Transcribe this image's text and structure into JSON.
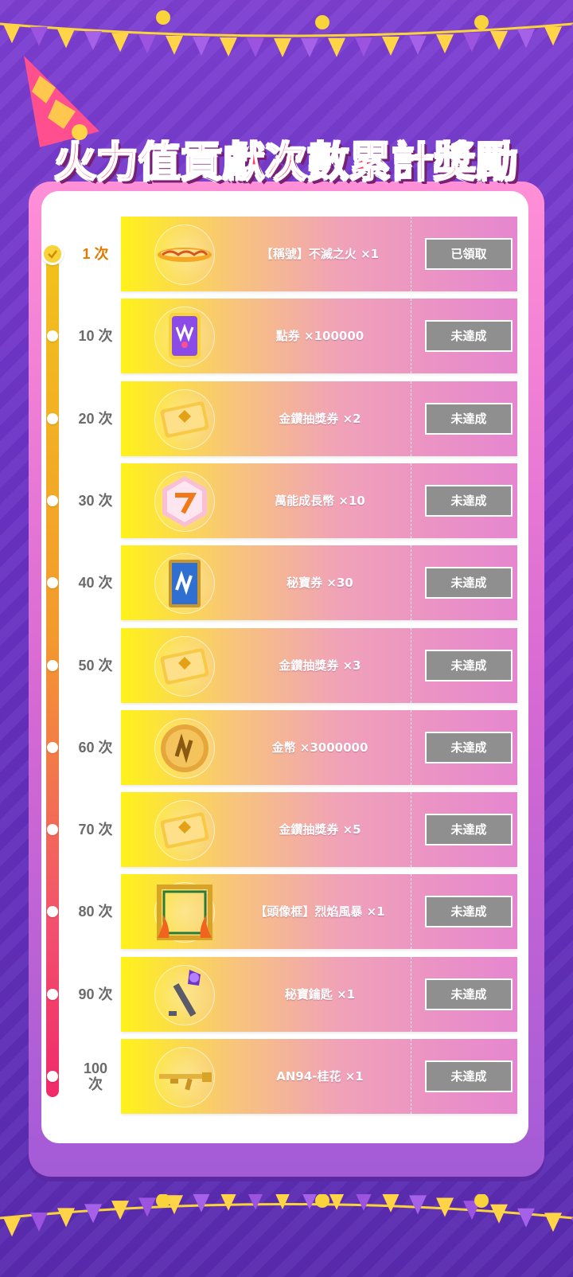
{
  "title": "火力值貢獻次數累計獎勵",
  "colors": {
    "accent_title": "#ff3b66",
    "button_gray": "#8f8f8f",
    "timeline_top": "#f2c21a",
    "timeline_bottom": "#f02a6a",
    "active_count": "#e07a00"
  },
  "rewards": [
    {
      "count": "1 次",
      "icon": "flaming-bar-icon",
      "reward": "【稱號】不滅之火 ×1",
      "status": "已領取",
      "done": true
    },
    {
      "count": "10 次",
      "icon": "voucher-card-icon",
      "reward": "點券 ×100000",
      "status": "未達成",
      "done": false
    },
    {
      "count": "20 次",
      "icon": "gold-ticket-icon",
      "reward": "金鑽抽獎券 ×2",
      "status": "未達成",
      "done": false
    },
    {
      "count": "30 次",
      "icon": "growth-coin-icon",
      "reward": "萬能成長幣 ×10",
      "status": "未達成",
      "done": false
    },
    {
      "count": "40 次",
      "icon": "treasure-card-icon",
      "reward": "秘寶券 ×30",
      "status": "未達成",
      "done": false
    },
    {
      "count": "50 次",
      "icon": "gold-ticket-icon",
      "reward": "金鑽抽獎券 ×3",
      "status": "未達成",
      "done": false
    },
    {
      "count": "60 次",
      "icon": "gold-coin-icon",
      "reward": "金幣 ×3000000",
      "status": "未達成",
      "done": false
    },
    {
      "count": "70 次",
      "icon": "gold-ticket-icon",
      "reward": "金鑽抽獎券 ×5",
      "status": "未達成",
      "done": false
    },
    {
      "count": "80 次",
      "icon": "avatar-frame-icon",
      "reward": "【頭像框】烈焰風暴 ×1",
      "status": "未達成",
      "done": false
    },
    {
      "count": "90 次",
      "icon": "treasure-key-icon",
      "reward": "秘寶鑰匙 ×1",
      "status": "未達成",
      "done": false
    },
    {
      "count": "100\n次",
      "icon": "golden-rifle-icon",
      "reward": "AN94-桂花 ×1",
      "status": "未達成",
      "done": false
    }
  ]
}
